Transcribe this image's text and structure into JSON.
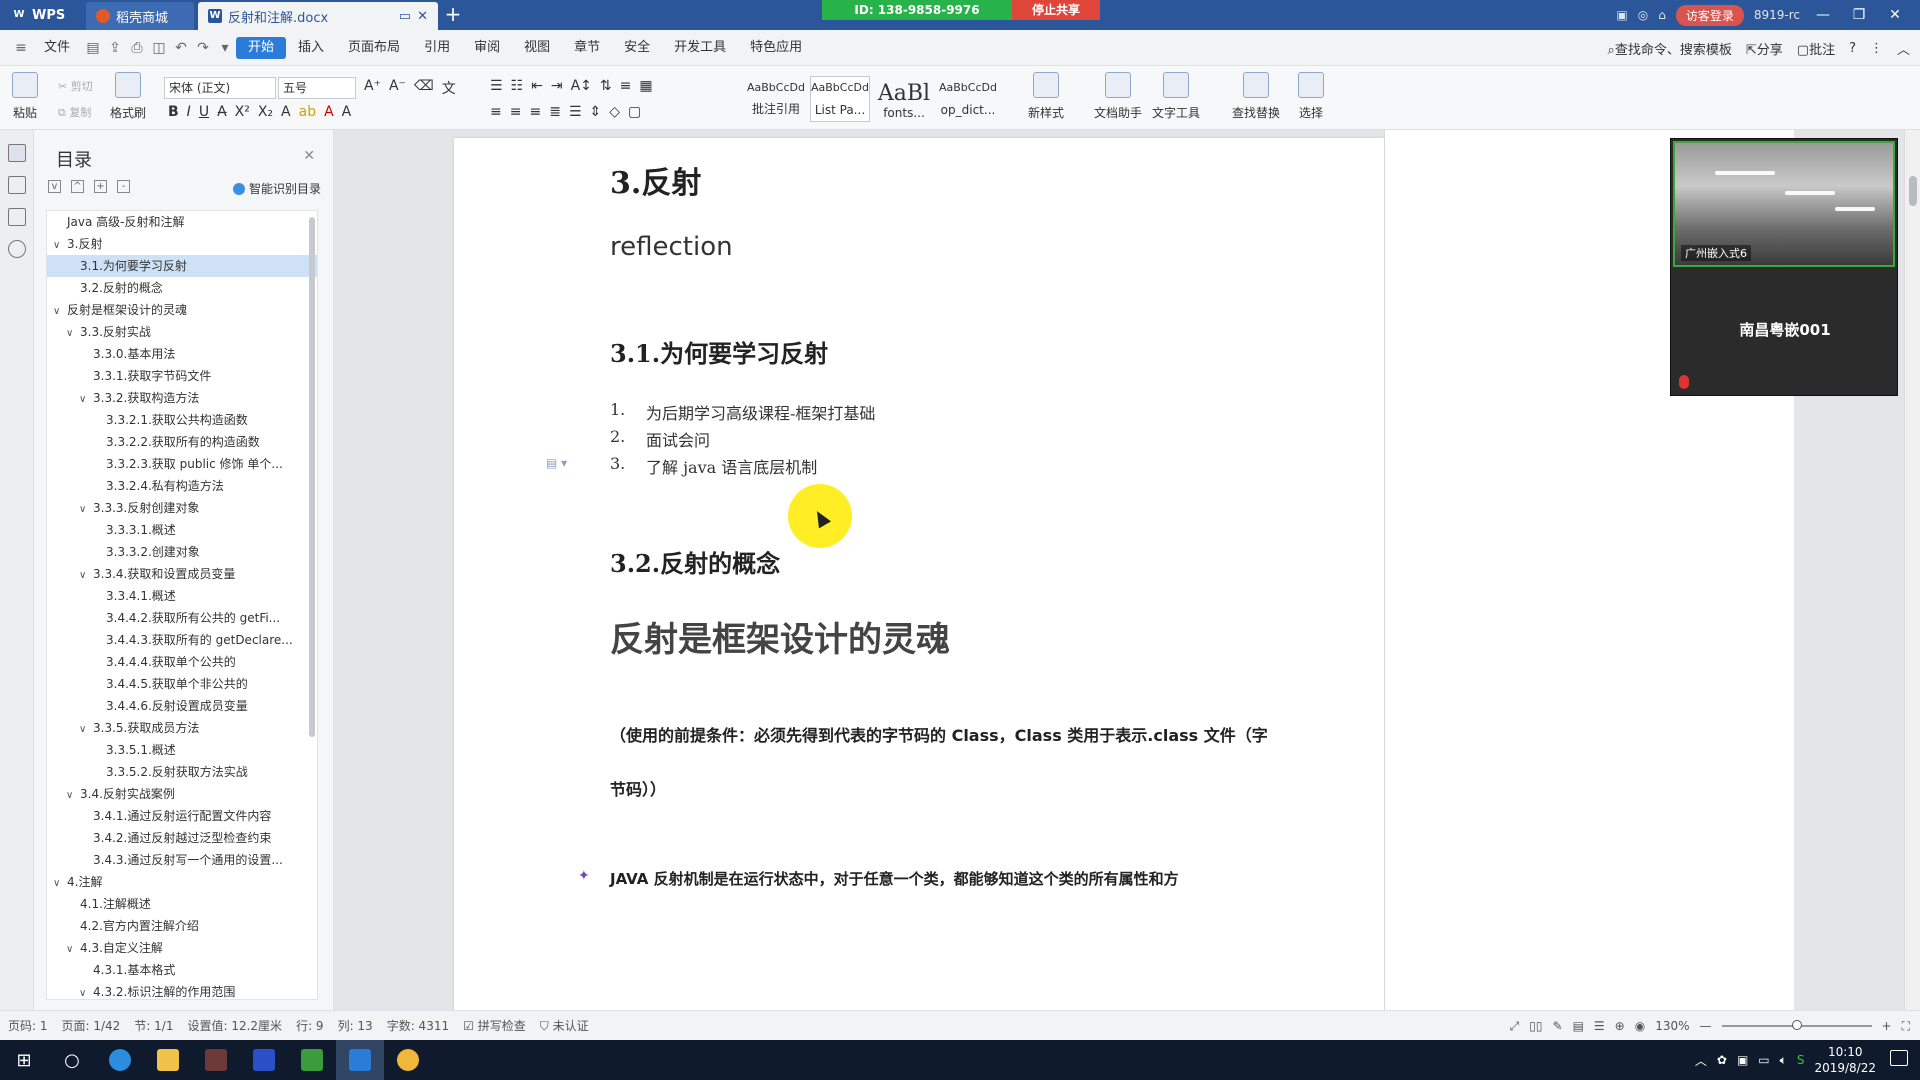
{
  "titlebar": {
    "app_tab": "WPS",
    "tabs": [
      {
        "label": "稻壳商城",
        "active": false
      },
      {
        "label": "反射和注解.docx",
        "active": true
      }
    ],
    "new_tab": "+",
    "share_id": "ID: 138-9858-9976",
    "share_stop": "停止共享",
    "visitor_login": "访客登录",
    "right_code": "8919-rc"
  },
  "menubar": {
    "file": "文件",
    "items": [
      "开始",
      "插入",
      "页面布局",
      "引用",
      "审阅",
      "视图",
      "章节",
      "安全",
      "开发工具",
      "特色应用"
    ],
    "active_index": 0,
    "search": "查找命令、搜索模板",
    "share": "分享",
    "comment": "批注"
  },
  "ribbon": {
    "paste": "粘贴",
    "cut": "剪切",
    "copy": "复制",
    "format_painter": "格式刷",
    "font_name": "宋体 (正文)",
    "font_size": "五号",
    "styles": [
      {
        "preview": "AaBbCcDd",
        "label": "批注引用"
      },
      {
        "preview": "AaBbCcDd",
        "label": "List Pa..."
      },
      {
        "preview": "AaBl",
        "label": "fonts..."
      },
      {
        "preview": "AaBbCcDd",
        "label": "op_dict..."
      }
    ],
    "new_style": "新样式",
    "doc_assistant": "文档助手",
    "text_tools": "文字工具",
    "find_replace": "查找替换",
    "select": "选择"
  },
  "toc": {
    "title": "目录",
    "smart": "智能识别目录",
    "items": [
      {
        "label": "Java 高级-反射和注解",
        "level": 0,
        "caret": ""
      },
      {
        "label": "3.反射",
        "level": 0,
        "caret": "v"
      },
      {
        "label": "3.1.为何要学习反射",
        "level": 1,
        "caret": "",
        "selected": true
      },
      {
        "label": "3.2.反射的概念",
        "level": 1,
        "caret": ""
      },
      {
        "label": "反射是框架设计的灵魂",
        "level": 0,
        "caret": "v"
      },
      {
        "label": "3.3.反射实战",
        "level": 1,
        "caret": "v"
      },
      {
        "label": "3.3.0.基本用法",
        "level": 2,
        "caret": ""
      },
      {
        "label": "3.3.1.获取字节码文件",
        "level": 2,
        "caret": ""
      },
      {
        "label": "3.3.2.获取构造方法",
        "level": 2,
        "caret": "v"
      },
      {
        "label": "3.3.2.1.获取公共构造函数",
        "level": 3,
        "caret": ""
      },
      {
        "label": "3.3.2.2.获取所有的构造函数",
        "level": 3,
        "caret": ""
      },
      {
        "label": "3.3.2.3.获取 public 修饰 单个...",
        "level": 3,
        "caret": ""
      },
      {
        "label": "3.3.2.4.私有构造方法",
        "level": 3,
        "caret": ""
      },
      {
        "label": "3.3.3.反射创建对象",
        "level": 2,
        "caret": "v"
      },
      {
        "label": "3.3.3.1.概述",
        "level": 3,
        "caret": ""
      },
      {
        "label": "3.3.3.2.创建对象",
        "level": 3,
        "caret": ""
      },
      {
        "label": "3.3.4.获取和设置成员变量",
        "level": 2,
        "caret": "v"
      },
      {
        "label": "3.3.4.1.概述",
        "level": 3,
        "caret": ""
      },
      {
        "label": "3.4.4.2.获取所有公共的 getFi...",
        "level": 3,
        "caret": ""
      },
      {
        "label": "3.4.4.3.获取所有的 getDeclare...",
        "level": 3,
        "caret": ""
      },
      {
        "label": "3.4.4.4.获取单个公共的",
        "level": 3,
        "caret": ""
      },
      {
        "label": "3.4.4.5.获取单个非公共的",
        "level": 3,
        "caret": ""
      },
      {
        "label": "3.4.4.6.反射设置成员变量",
        "level": 3,
        "caret": ""
      },
      {
        "label": "3.3.5.获取成员方法",
        "level": 2,
        "caret": "v"
      },
      {
        "label": "3.3.5.1.概述",
        "level": 3,
        "caret": ""
      },
      {
        "label": "3.3.5.2.反射获取方法实战",
        "level": 3,
        "caret": ""
      },
      {
        "label": "3.4.反射实战案例",
        "level": 1,
        "caret": "v"
      },
      {
        "label": "3.4.1.通过反射运行配置文件内容",
        "level": 2,
        "caret": ""
      },
      {
        "label": "3.4.2.通过反射越过泛型检查约束",
        "level": 2,
        "caret": ""
      },
      {
        "label": "3.4.3.通过反射写一个通用的设置...",
        "level": 2,
        "caret": ""
      },
      {
        "label": "4.注解",
        "level": 0,
        "caret": "v"
      },
      {
        "label": "4.1.注解概述",
        "level": 1,
        "caret": ""
      },
      {
        "label": "4.2.官方内置注解介绍",
        "level": 1,
        "caret": ""
      },
      {
        "label": "4.3.自定义注解",
        "level": 1,
        "caret": "v"
      },
      {
        "label": "4.3.1.基本格式",
        "level": 2,
        "caret": ""
      },
      {
        "label": "4.3.2.标识注解的作用范围",
        "level": 2,
        "caret": "v"
      }
    ]
  },
  "document": {
    "h_reflect": "3.反射",
    "subtitle": "reflection",
    "h_why": "3.1.为何要学习反射",
    "list": [
      {
        "num": "1.",
        "text": "为后期学习高级课程-框架打基础"
      },
      {
        "num": "2.",
        "text": "面试会问"
      },
      {
        "num": "3.",
        "text": "了解 java 语言底层机制"
      }
    ],
    "h_concept": "3.2.反射的概念",
    "h_soul": "反射是框架设计的灵魂",
    "note_line1": "（使用的前提条件：必须先得到代表的字节码的 Class，Class 类用于表示.class 文件（字",
    "note_line2": "节码））",
    "bullet_text": "JAVA 反射机制是在运行状态中，对于任意一个类，都能够知道这个类的所有属性和方"
  },
  "webcam": {
    "label": "广州嵌入式6",
    "name": "南昌粤嵌001"
  },
  "statusbar": {
    "page_num": "页码: 1",
    "pages": "页面: 1/42",
    "section": "节: 1/1",
    "setting": "设置值: 12.2厘米",
    "row": "行: 9",
    "col": "列: 13",
    "words": "字数: 4311",
    "spell": "拼写检查",
    "cert": "未认证",
    "zoom": "130%",
    "zoom_fraction": 0.5
  },
  "taskbar": {
    "time": "10:10",
    "date": "2019/8/22"
  },
  "colors": {
    "title_blue": "#2b579a",
    "menu_active": "#2b7bd8",
    "share_green": "#27b34a",
    "share_red": "#e0453a"
  }
}
